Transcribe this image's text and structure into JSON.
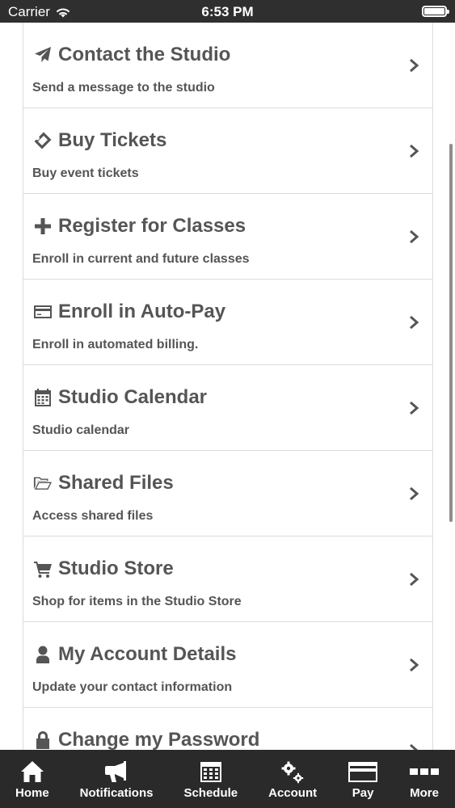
{
  "status_bar": {
    "carrier": "Carrier",
    "time": "6:53 PM"
  },
  "menu": {
    "items": [
      {
        "title": "Contact the Studio",
        "subtitle": "Send a message to the studio",
        "icon": "paper-plane-icon"
      },
      {
        "title": "Buy Tickets",
        "subtitle": "Buy event tickets",
        "icon": "ticket-icon"
      },
      {
        "title": "Register for Classes",
        "subtitle": "Enroll in current and future classes",
        "icon": "plus-icon"
      },
      {
        "title": "Enroll in Auto-Pay",
        "subtitle": "Enroll in automated billing.",
        "icon": "credit-card-icon"
      },
      {
        "title": "Studio Calendar",
        "subtitle": "Studio calendar",
        "icon": "calendar-icon"
      },
      {
        "title": "Shared Files",
        "subtitle": "Access shared files",
        "icon": "folder-open-icon"
      },
      {
        "title": "Studio Store",
        "subtitle": "Shop for items in the Studio Store",
        "icon": "cart-icon"
      },
      {
        "title": "My Account Details",
        "subtitle": "Update your contact information",
        "icon": "user-icon"
      },
      {
        "title": "Change my Password",
        "subtitle": "",
        "icon": "lock-icon"
      }
    ]
  },
  "tab_bar": {
    "tabs": [
      {
        "label": "Home",
        "icon": "home-icon"
      },
      {
        "label": "Notifications",
        "icon": "megaphone-icon"
      },
      {
        "label": "Schedule",
        "icon": "calendar-grid-icon"
      },
      {
        "label": "Account",
        "icon": "gears-icon"
      },
      {
        "label": "Pay",
        "icon": "credit-card-icon"
      },
      {
        "label": "More",
        "icon": "more-icon"
      }
    ]
  },
  "colors": {
    "tab_bar_bg": "#2a2a2a",
    "status_bar_bg": "#2f2f2f",
    "text": "#555555"
  }
}
